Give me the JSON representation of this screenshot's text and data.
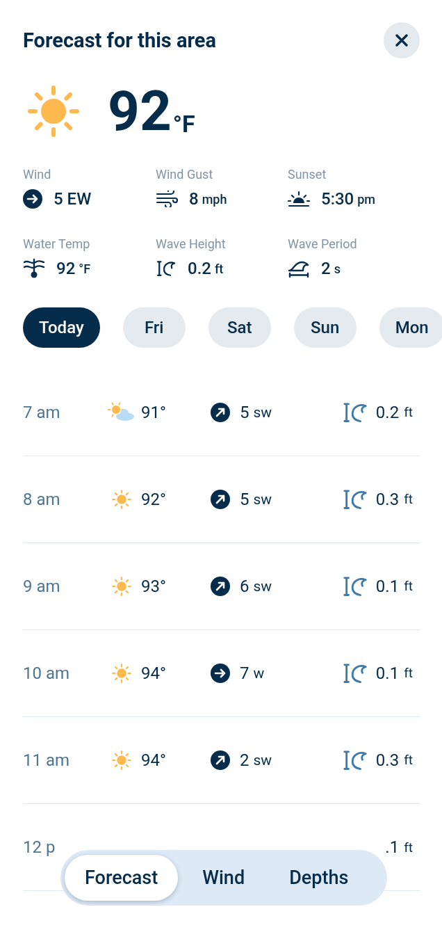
{
  "header": {
    "title": "Forecast for this area"
  },
  "current": {
    "kind": "sunny",
    "temperature": "92",
    "unit": "°F"
  },
  "stats": [
    {
      "kind": "arrow",
      "label": "Wind",
      "value": "5 EW"
    },
    {
      "kind": "gust",
      "label": "Wind Gust",
      "value": "8",
      "unit": "mph"
    },
    {
      "kind": "sunset",
      "label": "Sunset",
      "value": "5:30",
      "unit": "pm"
    },
    {
      "kind": "water",
      "label": "Water Temp",
      "value": "92",
      "unit": "°F"
    },
    {
      "kind": "height",
      "label": "Wave Height",
      "value": "0.2",
      "unit": "ft"
    },
    {
      "kind": "period",
      "label": "Wave Period",
      "value": "2",
      "unit": "s"
    }
  ],
  "days": [
    {
      "label": "Today",
      "selected": true
    },
    {
      "label": "Fri",
      "selected": false
    },
    {
      "label": "Sat",
      "selected": false
    },
    {
      "label": "Sun",
      "selected": false
    },
    {
      "label": "Mon",
      "selected": false
    }
  ],
  "hours": [
    {
      "time": "7 am",
      "weather": {
        "kind": "cloudy",
        "temp": "91°"
      },
      "wind": {
        "kind": "diagonal",
        "speed": "5",
        "direction": "sw"
      },
      "wave": "0.2",
      "wave_unit": "ft"
    },
    {
      "time": "8 am",
      "weather": {
        "kind": "sunny",
        "temp": "92°"
      },
      "wind": {
        "kind": "diagonal",
        "speed": "5",
        "direction": "sw"
      },
      "wave": "0.3",
      "wave_unit": "ft"
    },
    {
      "time": "9 am",
      "weather": {
        "kind": "sunny",
        "temp": "93°"
      },
      "wind": {
        "kind": "diagonal",
        "speed": "6",
        "direction": "sw"
      },
      "wave": "0.1",
      "wave_unit": "ft"
    },
    {
      "time": "10 am",
      "weather": {
        "kind": "sunny",
        "temp": "94°"
      },
      "wind": {
        "kind": "straight",
        "speed": "7",
        "direction": "w"
      },
      "wave": "0.1",
      "wave_unit": "ft"
    },
    {
      "time": "11 am",
      "weather": {
        "kind": "sunny",
        "temp": "94°"
      },
      "wind": {
        "kind": "diagonal",
        "speed": "2",
        "direction": "sw"
      },
      "wave": "0.3",
      "wave_unit": "ft"
    },
    {
      "time": "12 p",
      "wave": ".1",
      "wave_unit": "ft"
    }
  ],
  "bottom_tabs": [
    {
      "label": "Forecast",
      "selected": true
    },
    {
      "label": "Wind",
      "selected": false
    },
    {
      "label": "Depths",
      "selected": false
    }
  ]
}
